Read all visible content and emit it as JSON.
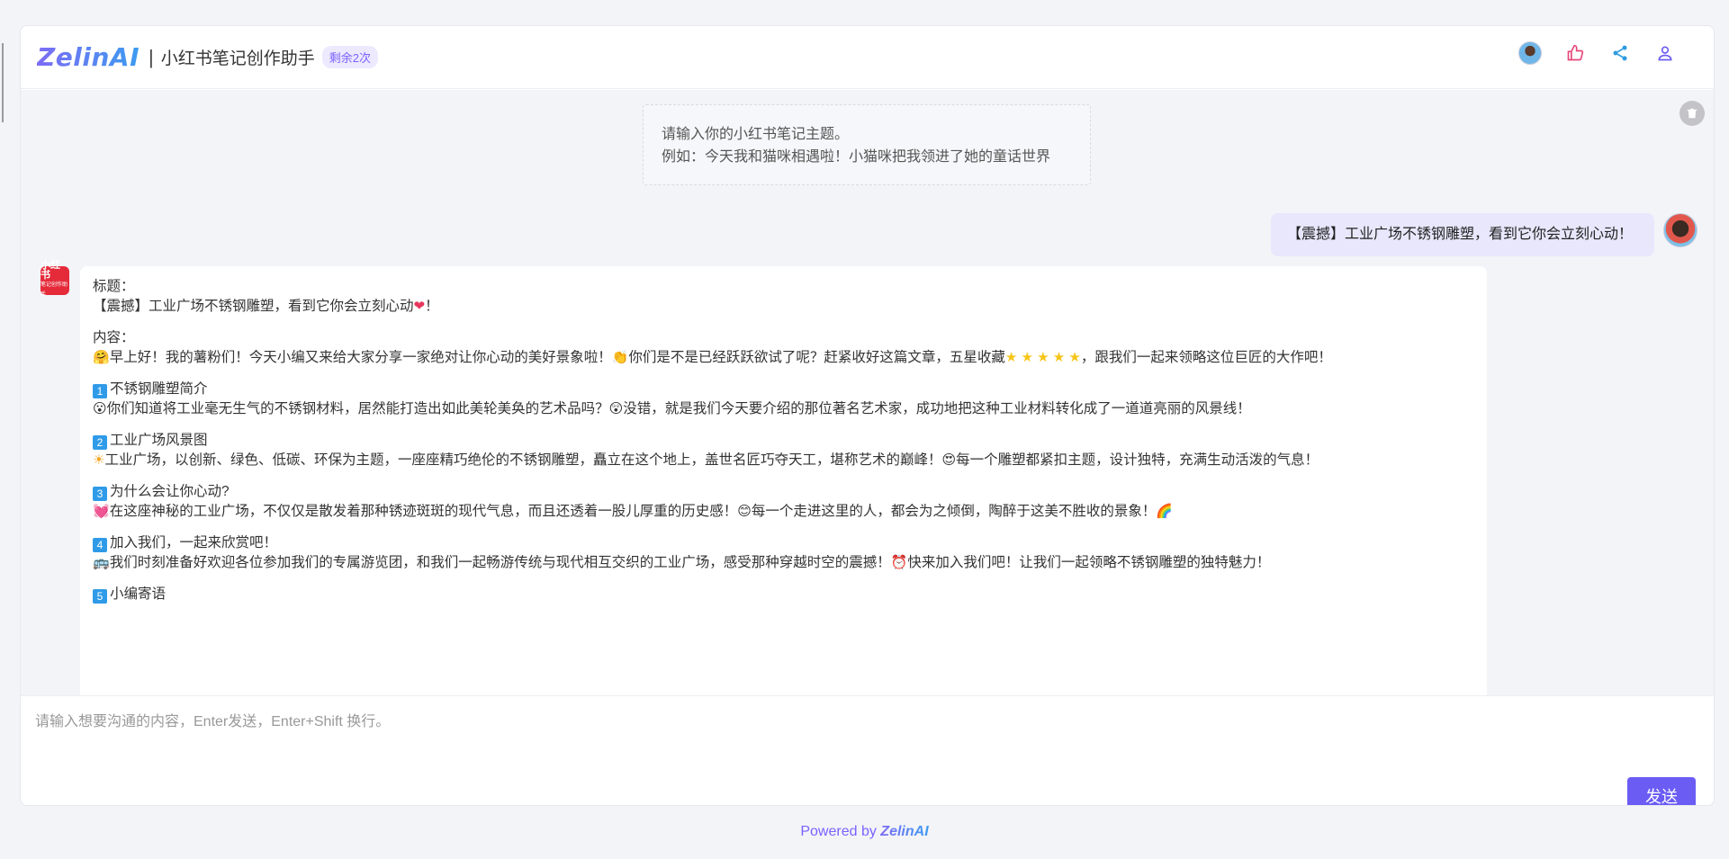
{
  "header": {
    "logo": "ZelinAI",
    "separator": "|",
    "title": "小红书笔记创作助手",
    "badge": "剩余2次"
  },
  "hint": {
    "line1": "请输入你的小红书笔记主题。",
    "line2": "例如：今天我和猫咪相遇啦！小猫咪把我领进了她的童话世界"
  },
  "user_message": "【震撼】工业广场不锈钢雕塑，看到它你会立刻心动！",
  "bot": {
    "avatar_text": "小红书",
    "avatar_sub": "笔记创作助手",
    "title_label": "标题：",
    "title_text": "【震撼】工业广场不锈钢雕塑，看到它你会立刻心动",
    "title_end": "！",
    "content_label": "内容：",
    "intro_a": "早上好！我的薯粉们！今天小编又来给大家分享一家绝对让你心动的美好景象啦！",
    "intro_b": "你们是不是已经跃跃欲试了呢？赶紧收好这篇文章，五星收藏",
    "intro_c": "，跟我们一起来领略这位巨匠的大作吧！",
    "sections": [
      {
        "num": "1",
        "heading": "不锈钢雕塑简介",
        "text_a": "你们知道将工业毫无生气的不锈钢材料，居然能打造出如此美轮美奂的艺术品吗？",
        "text_b": "没错，就是我们今天要介绍的那位著名艺术家，成功地把这种工业材料转化成了一道道亮丽的风景线！"
      },
      {
        "num": "2",
        "heading": "工业广场风景图",
        "text_a": "工业广场，以创新、绿色、低碳、环保为主题，一座座精巧绝伦的不锈钢雕塑，矗立在这个地上，盖世名匠巧夺天工，堪称艺术的巅峰！",
        "text_b": "每一个雕塑都紧扣主题，设计独特，充满生动活泼的气息！"
      },
      {
        "num": "3",
        "heading": "为什么会让你心动?",
        "text_a": "在这座神秘的工业广场，不仅仅是散发着那种锈迹斑斑的现代气息，而且还透着一股儿厚重的历史感！",
        "text_b": "每一个走进这里的人，都会为之倾倒，陶醉于这美不胜收的景象！"
      },
      {
        "num": "4",
        "heading": "加入我们，一起来欣赏吧！",
        "text_a": "我们时刻准备好欢迎各位参加我们的专属游览团，和我们一起畅游传统与现代相互交织的工业广场，感受那种穿越时空的震撼！",
        "text_b": "快来加入我们吧！让我们一起领略不锈钢雕塑的独特魅力！"
      },
      {
        "num": "5",
        "heading": "小编寄语"
      }
    ]
  },
  "input": {
    "placeholder": "请输入想要沟通的内容，Enter发送，Enter+Shift 换行。"
  },
  "send_label": "发送",
  "footer": {
    "prefix": "Powered by ",
    "brand": "ZelinAI"
  },
  "colors": {
    "accent": "#6b5cf4",
    "user_bubble": "#e8e7fc",
    "brand_red": "#e52a3a"
  }
}
